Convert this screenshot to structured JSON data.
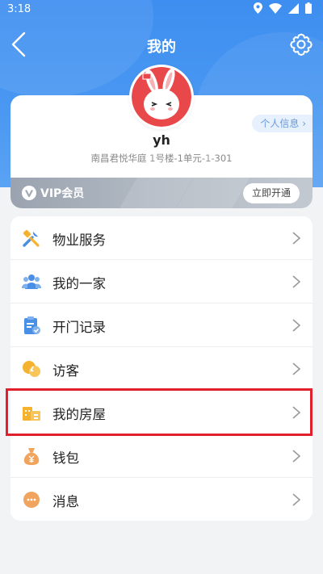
{
  "status_bar": {
    "time": "3:18"
  },
  "header": {
    "title": "我的"
  },
  "profile": {
    "username": "yh",
    "address": "南昌君悦华庭 1号楼-1单元-1-301",
    "info_button": "个人信息 ›"
  },
  "vip": {
    "label": "VIP会员",
    "button": "立即开通"
  },
  "menu": {
    "items": [
      {
        "label": "物业服务",
        "icon": "tools-icon"
      },
      {
        "label": "我的一家",
        "icon": "family-icon"
      },
      {
        "label": "开门记录",
        "icon": "clipboard-check-icon"
      },
      {
        "label": "访客",
        "icon": "visitor-icon"
      },
      {
        "label": "我的房屋",
        "icon": "house-icon"
      },
      {
        "label": "钱包",
        "icon": "money-bag-icon"
      },
      {
        "label": "消息",
        "icon": "message-icon"
      }
    ]
  },
  "colors": {
    "header_blue": "#3d8ef0",
    "icon_blue": "#4a8fe6",
    "icon_orange": "#f5b22f",
    "highlight_red": "#e0202c"
  }
}
